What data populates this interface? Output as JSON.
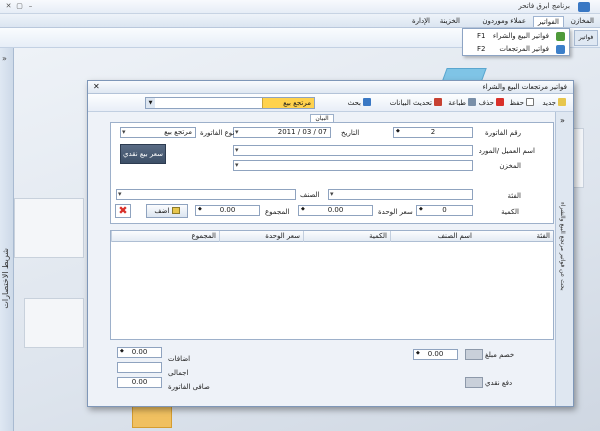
{
  "window": {
    "title": "برنامج ابرق فاتحر"
  },
  "menubar": {
    "items": [
      "المخازن",
      "الفواتير",
      "عملاء وموردون",
      "الخزينة",
      "الإدارة"
    ],
    "active_index": 1
  },
  "ribbon": {
    "button_label": "فواتير"
  },
  "dropdown": {
    "items": [
      {
        "label": "فواتير البيع والشراء",
        "shortcut": "F1"
      },
      {
        "label": "فواتير المرتجعات",
        "shortcut": "F2"
      }
    ]
  },
  "leftbar": {
    "label": "شريط الاختصارات"
  },
  "dialog": {
    "title": "فواتير مرتجعات البيع والشراء",
    "toolbar": {
      "new": "جديد",
      "save": "حفظ",
      "delete": "حذف",
      "print": "طباعة",
      "refresh": "تحديث البيانات",
      "search": "بحث"
    },
    "search_type": "مرتجع بيع",
    "side_label": "بحث عن فواتير مرتجع البيع والشراء",
    "section_label": "البيان",
    "fields": {
      "invoice_no_label": "رقم الفاتورة",
      "invoice_no": "2",
      "date_label": "التاريخ",
      "date": "2011 / 03 / 07",
      "invoice_type_label": "نوع الفاتورة",
      "invoice_type": "مرتجع بيع",
      "customer_label": "اسم العميل /المورد",
      "store_label": "المخزن",
      "cash_price_btn": "سعر بيع نقدي",
      "category_label": "الفئة",
      "item_label": "الصنف",
      "qty_label": "الكمية",
      "qty": "0",
      "unit_price_label": "سعر الوحدة",
      "unit_price": "0.00",
      "total_label": "المجموع",
      "total": "0.00",
      "add_btn": "اضف"
    },
    "grid": {
      "headers": [
        "الفئة",
        "اسم الصنف",
        "الكمية",
        "سعر الوحدة",
        "المجموع"
      ]
    },
    "footer": {
      "discount_btn": "خصم مبلغ",
      "discount_value": "0.00",
      "cash_pay_btn": "دفع نقدي",
      "additions_label": "اضافات",
      "additions": "0.00",
      "total_label": "اجمالى",
      "total": "",
      "net_label": "صافى الفاتورة",
      "net": "0.00"
    }
  },
  "colors": {
    "accent": "#ffd24d",
    "frame": "#7f97b8",
    "delete_red": "#d9302a"
  }
}
